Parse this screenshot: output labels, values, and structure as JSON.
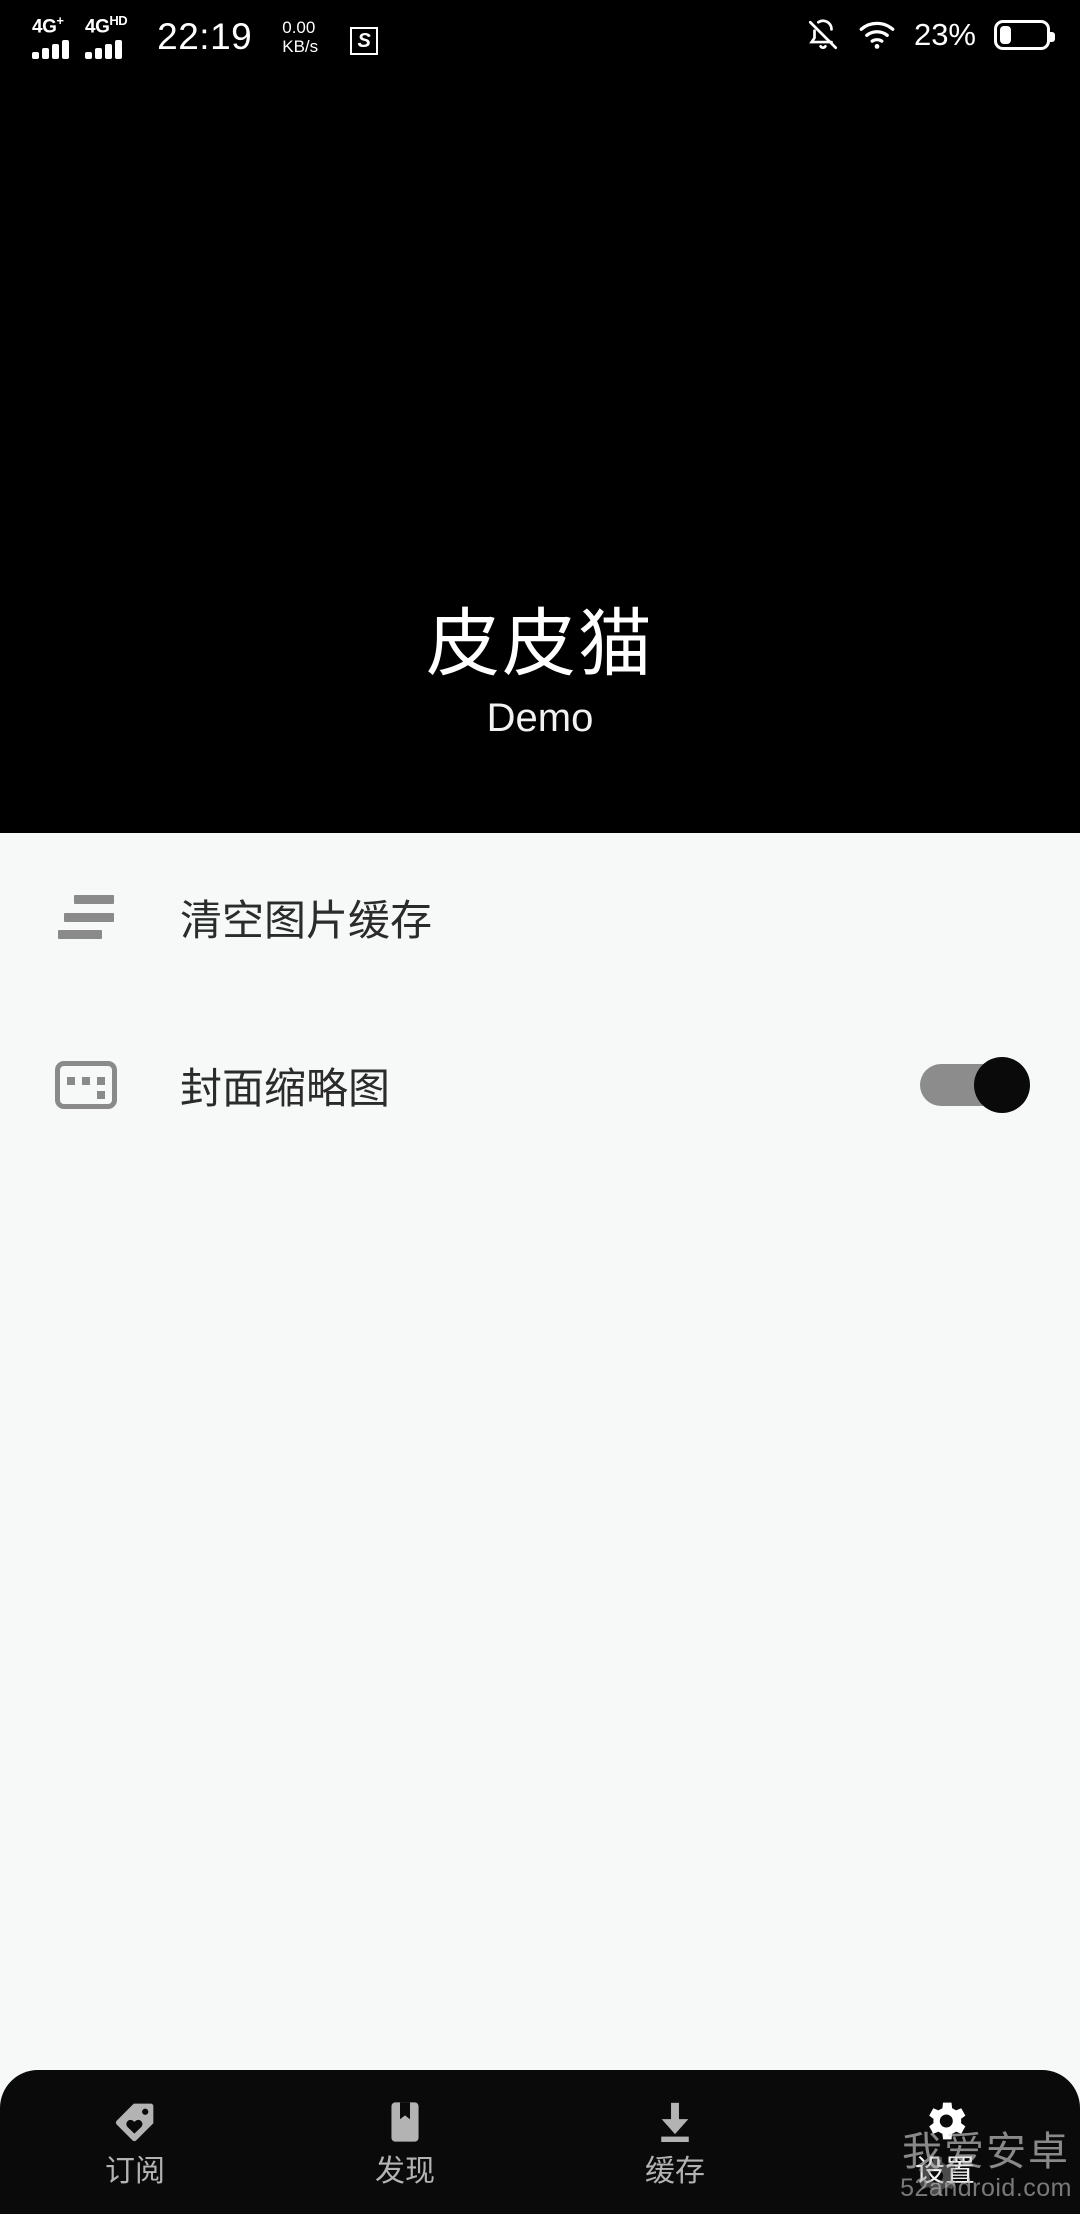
{
  "status_bar": {
    "signal_1": {
      "label": "4G",
      "sup": "+",
      "icon": "signal-bars-icon"
    },
    "signal_2": {
      "label": "4G",
      "sup": "HD",
      "icon": "signal-bars-icon"
    },
    "clock": "22:19",
    "net_speed_value": "0.00",
    "net_speed_unit": "KB/s",
    "app_badge": "S",
    "bell_icon": "bell-muted-icon",
    "wifi_icon": "wifi-icon",
    "battery_percent": "23%",
    "battery_level": 23,
    "battery_icon": "battery-icon"
  },
  "header": {
    "title": "皮皮猫",
    "subtitle": "Demo",
    "background": "#000000"
  },
  "settings_list": [
    {
      "icon": "sort-lines-icon",
      "label": "清空图片缓存",
      "control": "none"
    },
    {
      "icon": "thumbnail-icon",
      "label": "封面缩略图",
      "control": "toggle",
      "toggle_on": true
    }
  ],
  "bottom_nav": {
    "active_index": 3,
    "items": [
      {
        "label": "订阅",
        "icon": "tag-heart-icon"
      },
      {
        "label": "发现",
        "icon": "bookmark-icon"
      },
      {
        "label": "缓存",
        "icon": "download-icon"
      },
      {
        "label": "设置",
        "icon": "gear-icon"
      }
    ]
  },
  "watermark": {
    "main": "我爱安卓",
    "sub": "52android.com",
    "icon": "gear-icon"
  },
  "colors": {
    "header_bg": "#000000",
    "content_bg": "#f7f8f8",
    "nav_bg": "#0a0a0a",
    "icon_gray": "#8a8a8a",
    "nav_icon_inactive": "#b3b3b3",
    "nav_icon_active": "#ffffff",
    "toggle_track": "#8c8c8c",
    "toggle_thumb": "#0a0a0a",
    "text_primary": "#2b2b2b"
  }
}
